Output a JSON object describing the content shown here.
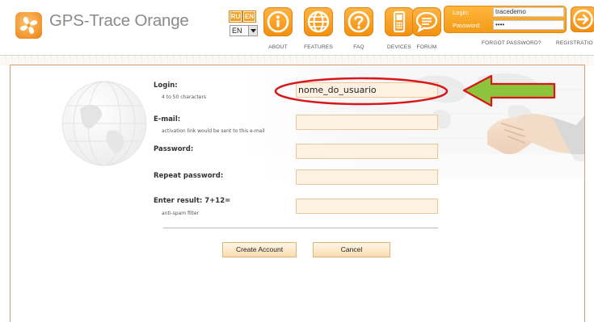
{
  "brand": {
    "logo_text": "GPS-Trace Orange",
    "accent_color": "#f39a17",
    "logo_icon": "fan-logo-icon"
  },
  "language": {
    "flags": [
      "RU",
      "EN"
    ],
    "selected": "EN"
  },
  "nav": {
    "items": [
      {
        "label": "ABOUT",
        "icon": "info-icon"
      },
      {
        "label": "FEATURES",
        "icon": "globe-icon"
      },
      {
        "label": "FAQ",
        "icon": "question-icon"
      },
      {
        "label": "DEVICES",
        "icon": "phone-icon"
      },
      {
        "label": "FORUM",
        "icon": "chat-bubble-icon"
      }
    ]
  },
  "login_panel": {
    "login_label": "Login:",
    "login_value": "tracedemo",
    "password_label": "Password:",
    "password_value": "••••",
    "go_icon": "arrow-right-icon",
    "forgot_password": "FORGOT PASSWORD?",
    "registration": "REGISTRATIO"
  },
  "form": {
    "login_label": "Login:",
    "login_hint": "4 to 50 characters",
    "login_value": "nome_do_usuario",
    "email_label": "E-mail:",
    "email_hint": "activation link would be sent to this e-mail",
    "email_value": "",
    "password_label": "Password:",
    "password_value": "",
    "repeat_password_label": "Repeat password:",
    "repeat_password_value": "",
    "captcha_label": "Enter result: 7+12=",
    "captcha_hint": "anti-spam filter",
    "captcha_value": "",
    "create_button": "Create Account",
    "cancel_button": "Cancel"
  },
  "annotation": {
    "highlight_color": "#d8161b",
    "arrow_color": "#8cc43c"
  }
}
